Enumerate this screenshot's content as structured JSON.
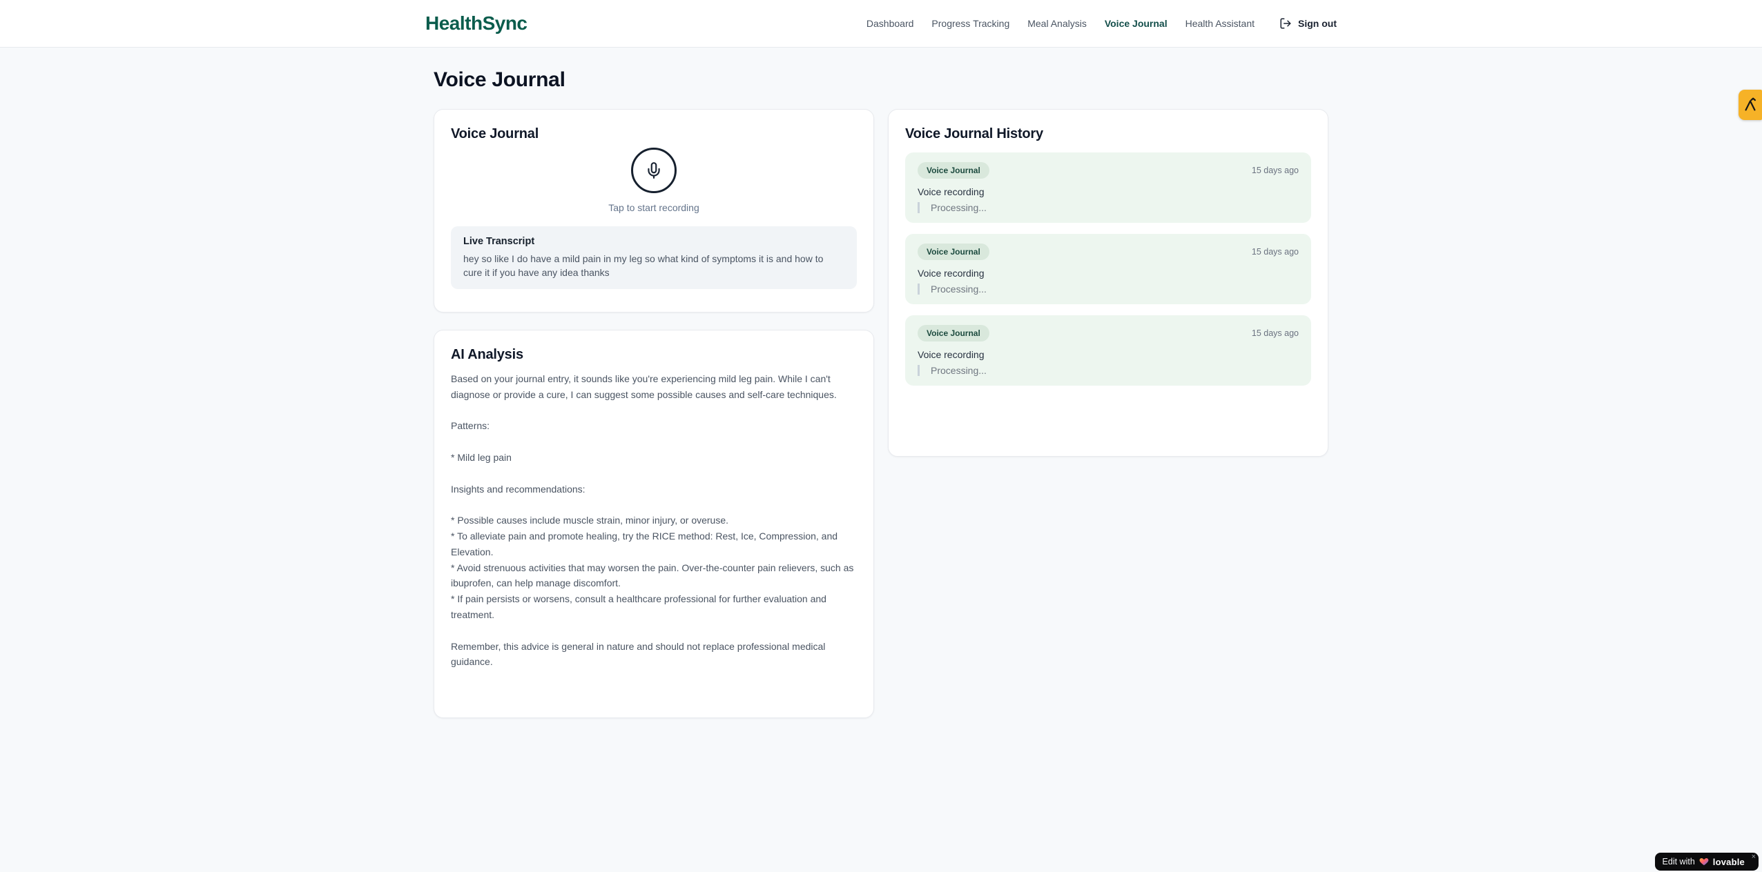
{
  "brand": {
    "name": "HealthSync"
  },
  "nav": {
    "items": [
      {
        "label": "Dashboard",
        "active": false
      },
      {
        "label": "Progress Tracking",
        "active": false
      },
      {
        "label": "Meal Analysis",
        "active": false
      },
      {
        "label": "Voice Journal",
        "active": true
      },
      {
        "label": "Health Assistant",
        "active": false
      }
    ],
    "sign_out_label": "Sign out"
  },
  "page": {
    "title": "Voice Journal"
  },
  "recorder": {
    "title": "Voice Journal",
    "tap_hint": "Tap to start recording",
    "live_transcript_label": "Live Transcript",
    "transcript": "hey so like I do have a mild pain in my leg so what kind of symptoms it is and how to cure it if you have any idea thanks"
  },
  "analysis": {
    "title": "AI Analysis",
    "body": "Based on your journal entry, it sounds like you're experiencing mild leg pain. While I can't diagnose or provide a cure, I can suggest some possible causes and self-care techniques.\n\nPatterns:\n\n* Mild leg pain\n\nInsights and recommendations:\n\n* Possible causes include muscle strain, minor injury, or overuse.\n* To alleviate pain and promote healing, try the RICE method: Rest, Ice, Compression, and Elevation.\n* Avoid strenuous activities that may worsen the pain. Over-the-counter pain relievers, such as ibuprofen, can help manage discomfort.\n* If pain persists or worsens, consult a healthcare professional for further evaluation and treatment.\n\nRemember, this advice is general in nature and should not replace professional medical guidance."
  },
  "history": {
    "title": "Voice Journal History",
    "entries": [
      {
        "badge": "Voice Journal",
        "time": "15 days ago",
        "description": "Voice recording",
        "status": "Processing..."
      },
      {
        "badge": "Voice Journal",
        "time": "15 days ago",
        "description": "Voice recording",
        "status": "Processing..."
      },
      {
        "badge": "Voice Journal",
        "time": "15 days ago",
        "description": "Voice recording",
        "status": "Processing..."
      }
    ]
  },
  "overlays": {
    "edit_badge": {
      "prefix": "Edit with",
      "brand": "lovable",
      "close": "×"
    }
  },
  "colors": {
    "brand_green": "#0a5c4c",
    "active_nav": "#134e4a",
    "page_bg": "#f7f9fb",
    "entry_bg": "#edf6ef",
    "badge_bg": "#d9e8dc",
    "badge_text": "#1c4a3e",
    "transcript_bg": "#f1f4f7",
    "amber_tab": "#f6b227",
    "lovable_pill": "#0c0c0d"
  }
}
